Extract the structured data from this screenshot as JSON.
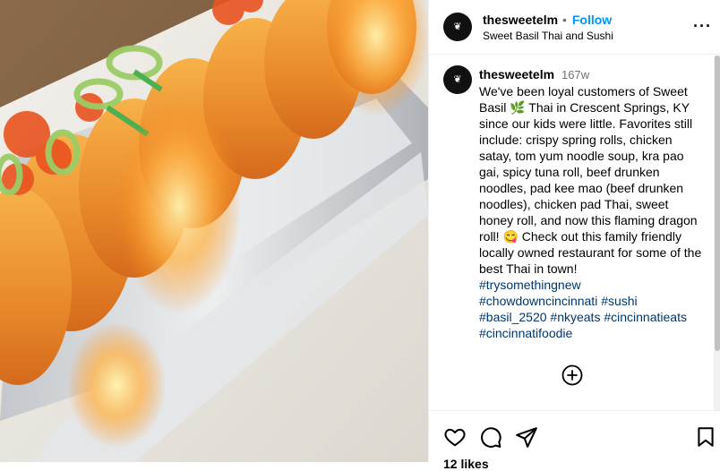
{
  "post": {
    "username": "thesweetelm",
    "follow_label": "Follow",
    "separator": "•",
    "location": "Sweet Basil Thai and Sushi"
  },
  "caption": {
    "username": "thesweetelm",
    "time": "167w",
    "text": "We've been loyal customers of Sweet Basil 🌿 Thai in Crescent Springs, KY since our kids were little. Favorites still include: crispy spring rolls, chicken satay, tom yum noodle soup, kra pao gai, spicy tuna roll, beef drunken noodles, pad kee mao (beef drunken noodles), chicken pad Thai, sweet honey roll, and now this flaming dragon roll! 😋 Check out this family friendly locally owned restaurant for some of the best Thai in town!",
    "hashtag_lines": [
      [
        "#trysomethingnew"
      ],
      [
        "#chowdowncincinnati",
        "#sushi"
      ],
      [
        "#basil_2520",
        "#nkyeats",
        "#cincinnatieats"
      ],
      [
        "#cincinnatifoodie"
      ]
    ]
  },
  "likes": "12 likes",
  "icons": {
    "more": "more-options-icon",
    "comments": "plus-circle-icon",
    "like": "heart-icon",
    "comment": "comment-icon",
    "share": "share-icon",
    "save": "bookmark-icon"
  },
  "colors": {
    "follow": "#0095f6",
    "hashtag": "#00376b",
    "muted": "#737373"
  }
}
